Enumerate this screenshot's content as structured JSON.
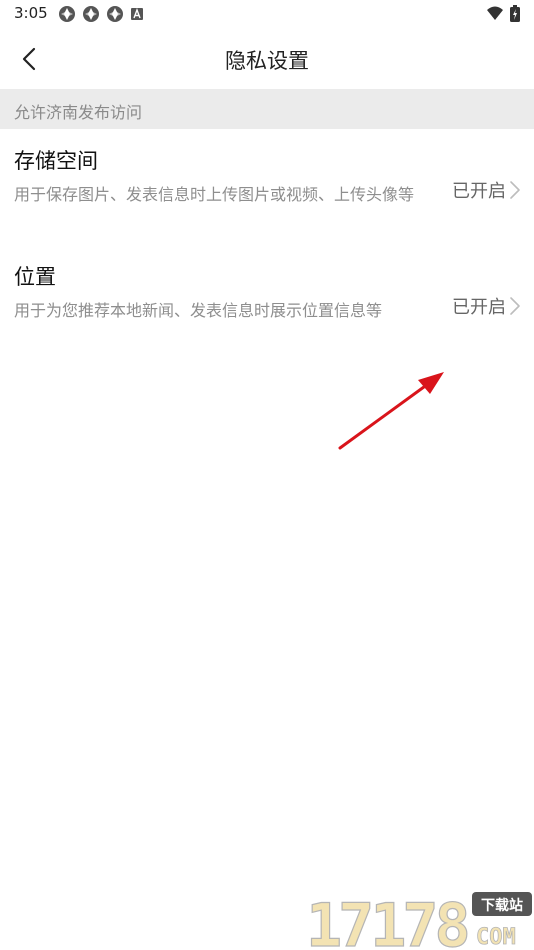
{
  "status_bar": {
    "time": "3:05"
  },
  "header": {
    "title": "隐私设置"
  },
  "section": {
    "title": "允许济南发布访问"
  },
  "permissions": [
    {
      "title": "存储空间",
      "description": "用于保存图片、发表信息时上传图片或视频、上传头像等",
      "status": "已开启"
    },
    {
      "title": "位置",
      "description": "用于为您推荐本地新闻、发表信息时展示位置信息等",
      "status": "已开启"
    }
  ],
  "watermark": {
    "number": "17178",
    "suffix": "COM",
    "badge": "下载站"
  },
  "colors": {
    "section_bg": "#ebebeb",
    "annotation_arrow": "#d9141b",
    "watermark_fill": "#f3e3b3"
  }
}
